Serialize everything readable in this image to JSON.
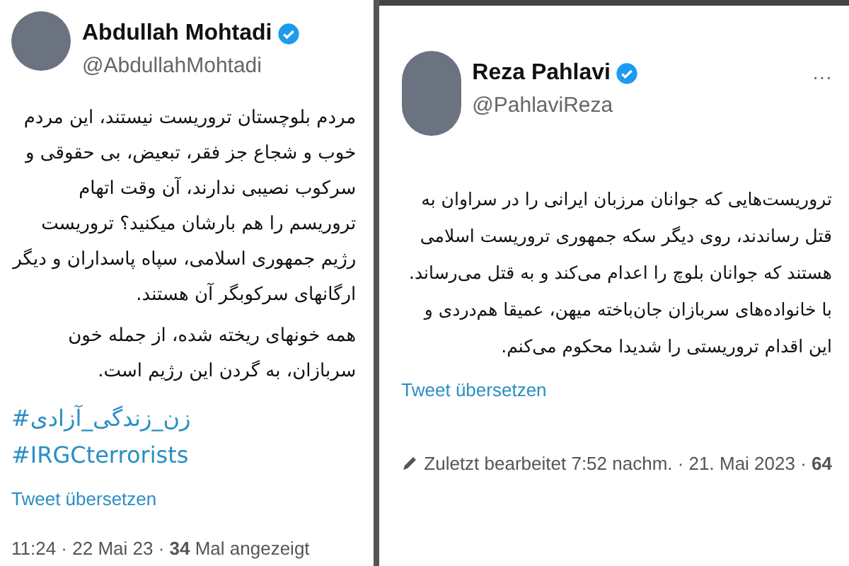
{
  "tweets": [
    {
      "name": "Abdullah Mohtadi",
      "verified": true,
      "handle": "@AbdullahMohtadi",
      "paragraphs": [
        "مردم بلوچستان تروریست نیستند، این مردم خوب و شجاع جز فقر، تبعیض، بی حقوقی و سرکوب نصیبی ندارند، آن وقت اتهام تروریسم را هم بارشان میکنید؟ تروریست رژیم جمهوری اسلامی، سپاه پاسداران و دیگر ارگانهای سرکوبگر آن هستند.",
        "همه خونهای ریخته شده، از جمله خون سربازان، به گردن این رژیم است."
      ],
      "hashtags": [
        "#زن_زندگی_آزادی",
        "#IRGCterrorists"
      ],
      "translate": "Tweet übersetzen",
      "meta": "11:24 · 22 Mai 23 · **34** Mal angezeigt",
      "edited": false
    },
    {
      "name": "Reza Pahlavi",
      "verified": true,
      "handle": "@PahlaviReza",
      "menu": "···",
      "paragraphs": [
        "تروریست‌هایی که جوانان مرزبان ایرانی را در سراوان به قتل رساندند، روی دیگر سکه جمهوری تروریست اسلامی هستند که جوانان بلوچ را اعدام می‌کند و به قتل می‌رساند. با خانواده‌های سربازان جان‌باخته میهن، عمیقا هم‌دردی و این اقدام تروریستی را شدیدا محکوم می‌کنم."
      ],
      "translate": "Tweet übersetzen",
      "meta": "Zuletzt bearbeitet 7:52 nachm. · 21. Mai 2023 · **64**",
      "edited": true
    }
  ]
}
